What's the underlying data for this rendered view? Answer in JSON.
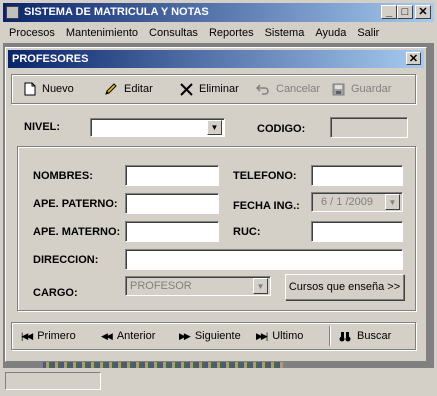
{
  "app": {
    "title": "SISTEMA DE MATRICULA Y NOTAS",
    "menu": [
      "Procesos",
      "Mantenimiento",
      "Consultas",
      "Reportes",
      "Sistema",
      "Ayuda",
      "Salir"
    ]
  },
  "form": {
    "title": "PROFESORES",
    "toolbar": {
      "nuevo": "Nuevo",
      "editar": "Editar",
      "eliminar": "Eliminar",
      "cancelar": "Cancelar",
      "guardar": "Guardar"
    },
    "nivel_label": "NIVEL:",
    "nivel_value": "",
    "codigo_label": "CODIGO:",
    "codigo_value": "",
    "fields": {
      "nombres_label": "NOMBRES:",
      "nombres_value": "",
      "telefono_label": "TELEFONO:",
      "telefono_value": "",
      "ape_paterno_label": "APE. PATERNO:",
      "ape_paterno_value": "",
      "fecha_ing_label": "FECHA ING.:",
      "fecha_ing_value": "6 / 1 /2009",
      "ape_materno_label": "APE. MATERNO:",
      "ape_materno_value": "",
      "ruc_label": "RUC:",
      "ruc_value": "",
      "direccion_label": "DIRECCION:",
      "direccion_value": "",
      "cargo_label": "CARGO:",
      "cargo_value": "PROFESOR",
      "cursos_button": "Cursos que enseña >>"
    },
    "nav": {
      "primero": "Primero",
      "anterior": "Anterior",
      "siguiente": "Siguiente",
      "ultimo": "Ultimo",
      "buscar": "Buscar"
    }
  },
  "icons": {
    "new": "new-document-icon",
    "edit": "pencil-icon",
    "delete": "x-icon",
    "cancel": "undo-icon",
    "save": "floppy-disk-icon",
    "first": "first-record-icon",
    "prev": "previous-record-icon",
    "next": "next-record-icon",
    "last": "last-record-icon",
    "search": "binoculars-icon"
  }
}
